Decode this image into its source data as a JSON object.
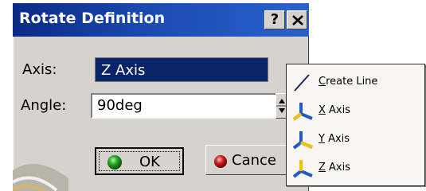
{
  "dialog": {
    "title": "Rotate Definition",
    "help_label": "?",
    "axis_label": "Axis:",
    "axis_value": "Z Axis",
    "angle_label": "Angle:",
    "angle_value": "90deg",
    "ok_label": "OK",
    "cancel_label": "Cance"
  },
  "menu": {
    "items": [
      {
        "mnemonic": "C",
        "rest": "reate Line",
        "icon": "line-icon"
      },
      {
        "mnemonic": "X",
        "rest": " Axis",
        "icon": "axis-icon"
      },
      {
        "mnemonic": "Y",
        "rest": " Axis",
        "icon": "axis-icon"
      },
      {
        "mnemonic": "Z",
        "rest": " Axis",
        "icon": "axis-icon"
      }
    ]
  },
  "colors": {
    "titlebar": "#0a2a86",
    "selection": "#0a246a",
    "dialog_bg": "#d6d3ce",
    "menu_bg": "#f7f6f2"
  }
}
